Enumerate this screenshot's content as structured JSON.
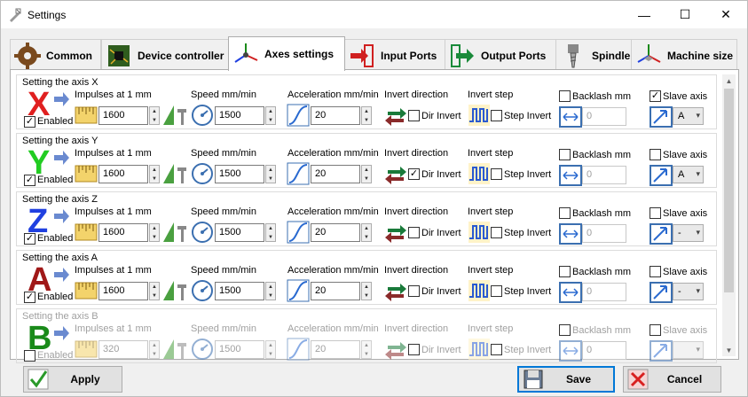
{
  "window": {
    "title": "Settings",
    "minimize": "—",
    "maximize": "☐",
    "close": "✕"
  },
  "tabs": [
    {
      "label": "Common",
      "icon": "gear-icon"
    },
    {
      "label": "Device controller",
      "icon": "circuit-board-icon"
    },
    {
      "label": "Axes settings",
      "icon": "axes-icon",
      "active": true
    },
    {
      "label": "Input Ports",
      "icon": "input-arrow-icon"
    },
    {
      "label": "Output Ports",
      "icon": "output-arrow-icon"
    },
    {
      "label": "Spindle",
      "icon": "spindle-icon"
    },
    {
      "label": "Machine size",
      "icon": "machine-size-icon"
    }
  ],
  "columns": {
    "impulses": "Impulses at 1 mm",
    "speed": "Speed mm/min",
    "accel": "Acceleration mm/min",
    "invert_dir": "Invert direction",
    "dir_invert": "Dir Invert",
    "invert_step": "Invert step",
    "step_invert": "Step Invert",
    "backlash": "Backlash mm",
    "slave": "Slave axis",
    "enabled": "Enabled"
  },
  "axes": [
    {
      "title": "Setting the axis X",
      "letter": "X",
      "color": "#e02020",
      "enabled": true,
      "impulses": "1600",
      "speed": "1500",
      "accel": "20",
      "dir_invert": false,
      "step_invert": false,
      "backlash_on": false,
      "backlash": "0",
      "slave_on": true,
      "slave": "A"
    },
    {
      "title": "Setting the axis Y",
      "letter": "Y",
      "color": "#22cc22",
      "enabled": true,
      "impulses": "1600",
      "speed": "1500",
      "accel": "20",
      "dir_invert": true,
      "step_invert": false,
      "backlash_on": false,
      "backlash": "0",
      "slave_on": false,
      "slave": "A"
    },
    {
      "title": "Setting the axis Z",
      "letter": "Z",
      "color": "#2040e0",
      "enabled": true,
      "impulses": "1600",
      "speed": "1500",
      "accel": "20",
      "dir_invert": false,
      "step_invert": false,
      "backlash_on": false,
      "backlash": "0",
      "slave_on": false,
      "slave": "-"
    },
    {
      "title": "Setting the axis A",
      "letter": "A",
      "color": "#a01818",
      "enabled": true,
      "impulses": "1600",
      "speed": "1500",
      "accel": "20",
      "dir_invert": false,
      "step_invert": false,
      "backlash_on": false,
      "backlash": "0",
      "slave_on": false,
      "slave": "-"
    },
    {
      "title": "Setting the axis B",
      "letter": "B",
      "color": "#1a8a1a",
      "enabled": false,
      "impulses": "320",
      "speed": "1500",
      "accel": "20",
      "dir_invert": false,
      "step_invert": false,
      "backlash_on": false,
      "backlash": "0",
      "slave_on": false,
      "slave": ""
    }
  ],
  "buttons": {
    "apply": "Apply",
    "save": "Save",
    "cancel": "Cancel"
  },
  "scrollbar": {
    "up": "▲",
    "down": "▼"
  },
  "glyphs": {
    "check": "✓",
    "dropdown": "▾",
    "spin_up": "▲",
    "spin_down": "▼"
  }
}
